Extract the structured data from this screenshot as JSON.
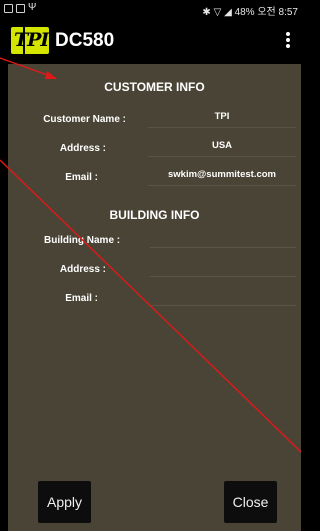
{
  "status_bar": {
    "right_text": "48% 오전 8:57"
  },
  "app_bar": {
    "logo_text": "TPI",
    "title": "DC580"
  },
  "customer_info": {
    "title": "CUSTOMER INFO",
    "name_label": "Customer Name :",
    "name_value": "TPI",
    "address_label": "Address :",
    "address_value": "USA",
    "email_label": "Email :",
    "email_value": "swkim@summitest.com"
  },
  "building_info": {
    "title": "BUILDING INFO",
    "name_label": "Building Name :",
    "name_value": "",
    "address_label": "Address :",
    "address_value": "",
    "email_label": "Email :",
    "email_value": ""
  },
  "buttons": {
    "apply": "Apply",
    "close": "Close"
  },
  "colors": {
    "background": "#4a4436",
    "logo_accent": "#d4e600",
    "annotation": "#e11818"
  }
}
